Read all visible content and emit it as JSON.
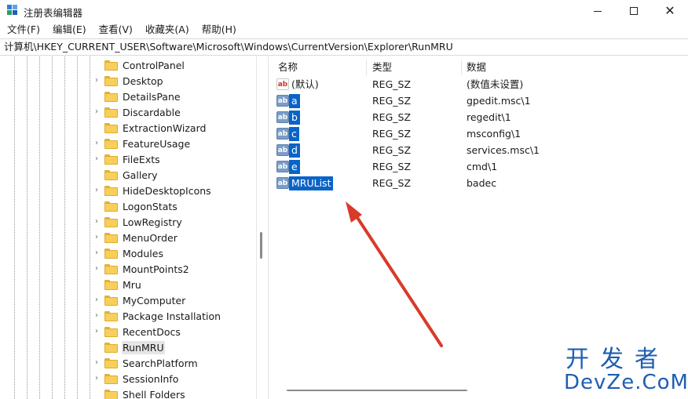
{
  "window": {
    "title": "注册表编辑器",
    "accent_color": "#0a64c8",
    "folder_color": "#f7cf5a"
  },
  "menu": {
    "items": [
      {
        "label": "文件(F)"
      },
      {
        "label": "编辑(E)"
      },
      {
        "label": "查看(V)"
      },
      {
        "label": "收藏夹(A)"
      },
      {
        "label": "帮助(H)"
      }
    ]
  },
  "address": {
    "path": "计算机\\HKEY_CURRENT_USER\\Software\\Microsoft\\Windows\\CurrentVersion\\Explorer\\RunMRU"
  },
  "tree": {
    "items": [
      {
        "label": "ControlPanel",
        "expandable": false,
        "selected": false
      },
      {
        "label": "Desktop",
        "expandable": true,
        "selected": false
      },
      {
        "label": "DetailsPane",
        "expandable": false,
        "selected": false
      },
      {
        "label": "Discardable",
        "expandable": true,
        "selected": false
      },
      {
        "label": "ExtractionWizard",
        "expandable": false,
        "selected": false
      },
      {
        "label": "FeatureUsage",
        "expandable": true,
        "selected": false
      },
      {
        "label": "FileExts",
        "expandable": true,
        "selected": false
      },
      {
        "label": "Gallery",
        "expandable": false,
        "selected": false
      },
      {
        "label": "HideDesktopIcons",
        "expandable": true,
        "selected": false
      },
      {
        "label": "LogonStats",
        "expandable": false,
        "selected": false
      },
      {
        "label": "LowRegistry",
        "expandable": true,
        "selected": false
      },
      {
        "label": "MenuOrder",
        "expandable": true,
        "selected": false
      },
      {
        "label": "Modules",
        "expandable": true,
        "selected": false
      },
      {
        "label": "MountPoints2",
        "expandable": true,
        "selected": false
      },
      {
        "label": "Mru",
        "expandable": false,
        "selected": false
      },
      {
        "label": "MyComputer",
        "expandable": true,
        "selected": false
      },
      {
        "label": "Package Installation",
        "expandable": true,
        "selected": false
      },
      {
        "label": "RecentDocs",
        "expandable": true,
        "selected": false
      },
      {
        "label": "RunMRU",
        "expandable": false,
        "selected": true
      },
      {
        "label": "SearchPlatform",
        "expandable": true,
        "selected": false
      },
      {
        "label": "SessionInfo",
        "expandable": true,
        "selected": false
      },
      {
        "label": "Shell Folders",
        "expandable": false,
        "selected": false
      }
    ]
  },
  "values": {
    "headers": {
      "name": "名称",
      "type": "类型",
      "data": "数据"
    },
    "rows": [
      {
        "icon": "ab",
        "name": "(默认)",
        "type": "REG_SZ",
        "data": "(数值未设置)",
        "highlight": false
      },
      {
        "icon": "ab",
        "name": "a",
        "type": "REG_SZ",
        "data": "gpedit.msc\\1",
        "highlight": true
      },
      {
        "icon": "ab",
        "name": "b",
        "type": "REG_SZ",
        "data": "regedit\\1",
        "highlight": true
      },
      {
        "icon": "ab",
        "name": "c",
        "type": "REG_SZ",
        "data": "msconfig\\1",
        "highlight": true
      },
      {
        "icon": "ab",
        "name": "d",
        "type": "REG_SZ",
        "data": "services.msc\\1",
        "highlight": true
      },
      {
        "icon": "ab",
        "name": "e",
        "type": "REG_SZ",
        "data": "cmd\\1",
        "highlight": true
      },
      {
        "icon": "ab",
        "name": "MRUList",
        "type": "REG_SZ",
        "data": "badec",
        "highlight": true
      }
    ]
  },
  "annotation": {
    "arrow_color": "#d93a2b"
  },
  "watermark": {
    "line1": "开发者",
    "line2": "DevZe.CoM",
    "color": "#1d5fb0"
  }
}
